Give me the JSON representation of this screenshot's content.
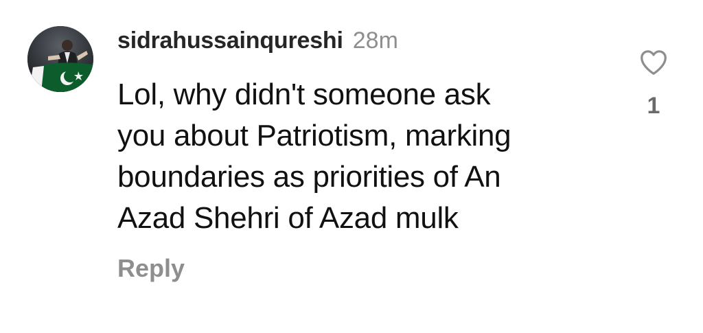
{
  "comment": {
    "username": "sidrahussainqureshi",
    "timestamp": "28m",
    "lines": [
      "Lol, why didn't someone ask",
      "you about Patriotism, marking",
      "boundaries as priorities of An",
      "Azad Shehri of Azad mulk"
    ],
    "reply_label": "Reply",
    "like_icon": "heart-outline-icon",
    "like_count": "1"
  },
  "colors": {
    "username": "#262626",
    "secondary_text": "#8e8e8e",
    "body_text": "#111111",
    "background": "#ffffff"
  }
}
